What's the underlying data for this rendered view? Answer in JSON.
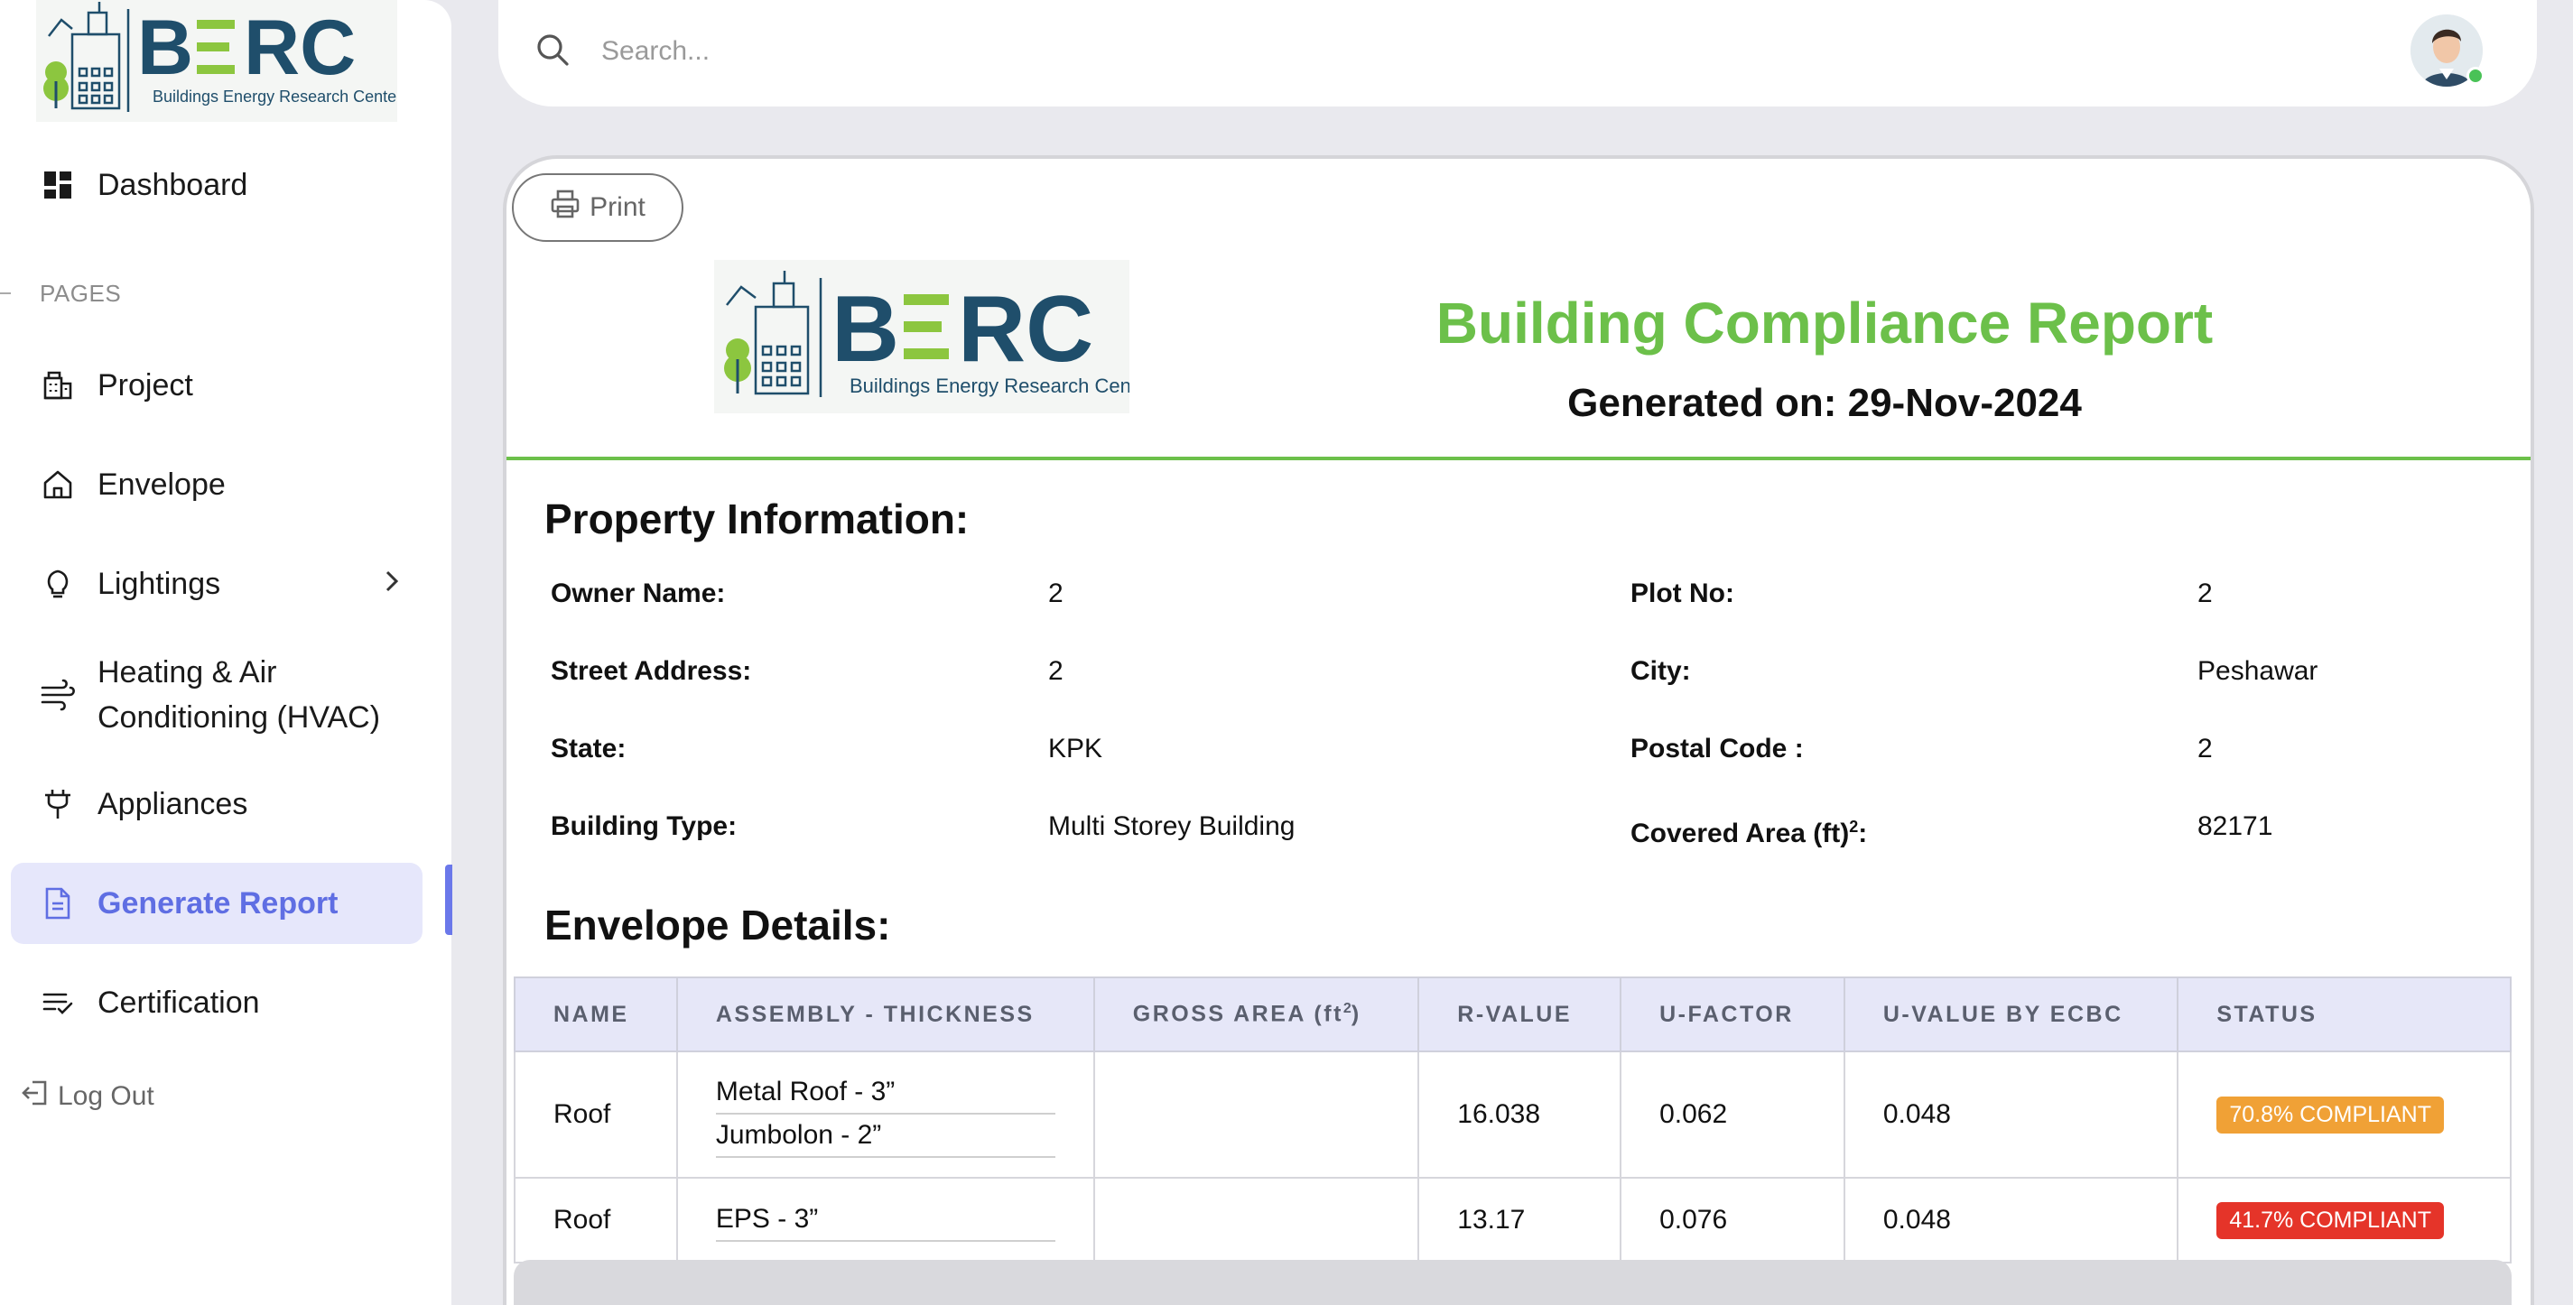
{
  "brand": {
    "logo_letters": "BERC",
    "logo_subtitle": "Buildings Energy Research Center"
  },
  "search": {
    "placeholder": "Search..."
  },
  "sidebar": {
    "dashboard_label": "Dashboard",
    "pages_label": "PAGES",
    "items": [
      {
        "label": "Project",
        "icon": "building-icon"
      },
      {
        "label": "Envelope",
        "icon": "home-icon"
      },
      {
        "label": "Lightings",
        "icon": "lightbulb-icon"
      },
      {
        "label": "Heating & Air",
        "label2": "Conditioning (HVAC)",
        "icon": "wind-icon"
      },
      {
        "label": "Appliances",
        "icon": "plug-icon"
      },
      {
        "label": "Generate Report",
        "icon": "document-icon",
        "active": true
      },
      {
        "label": "Certification",
        "icon": "list-check-icon"
      }
    ],
    "logout_label": "Log Out"
  },
  "report": {
    "print_label": "Print",
    "title": "Building Compliance Report",
    "generated_on": "Generated on: 29-Nov-2024",
    "property_heading": "Property Information:",
    "property": {
      "owner_label": "Owner Name:",
      "owner_value": "2",
      "plot_label": "Plot No:",
      "plot_value": "2",
      "street_label": "Street Address:",
      "street_value": "2",
      "city_label": "City:",
      "city_value": "Peshawar",
      "state_label": "State:",
      "state_value": "KPK",
      "postal_label": "Postal Code :",
      "postal_value": "2",
      "building_type_label": "Building Type:",
      "building_type_value": "Multi Storey Building",
      "covered_area_label": "Covered Area (ft)",
      "covered_area_sup": "2",
      "covered_area_suffix": ":",
      "covered_area_value": "82171"
    },
    "envelope_heading": "Envelope Details:",
    "envelope_columns": {
      "name": "NAME",
      "assembly": "ASSEMBLY - THICKNESS",
      "gross_area": "GROSS AREA (ft",
      "gross_area_sup": "2",
      "gross_area_close": ")",
      "r_value": "R-VALUE",
      "u_factor": "U-FACTOR",
      "u_value_ecbc": "U-VALUE BY ECBC",
      "status": "STATUS"
    },
    "envelope_rows": [
      {
        "name": "Roof",
        "assembly": [
          "Metal Roof - 3”",
          "Jumbolon - 2”"
        ],
        "gross_area": "",
        "r_value": "16.038",
        "u_factor": "0.062",
        "u_value_ecbc": "0.048",
        "status": "70.8% COMPLIANT",
        "status_color": "#f0a136"
      },
      {
        "name": "Roof",
        "assembly": [
          "EPS - 3”"
        ],
        "gross_area": "",
        "r_value": "13.17",
        "u_factor": "0.076",
        "u_value_ecbc": "0.048",
        "status": "41.7% COMPLIANT",
        "status_color": "#e53429"
      }
    ]
  },
  "colors": {
    "accent": "#6b78ea",
    "report_green": "#6cc04a",
    "logo_navy": "#1f4e6b",
    "logo_green": "#8cc63f"
  }
}
